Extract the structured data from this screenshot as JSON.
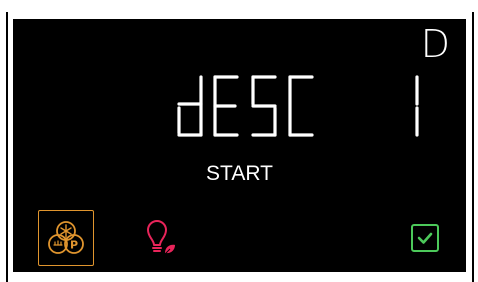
{
  "display": {
    "mode_letter": "D",
    "program_code": "dESC",
    "program_number": "1",
    "status": "START"
  },
  "icons": {
    "program": "snowflake-p-circles-icon",
    "light": "bulb-leaf-icon",
    "confirm": "checkbox-check-icon"
  },
  "colors": {
    "screen_background": "#000000",
    "text": "#ffffff",
    "program_accent": "#e0952e",
    "light_accent": "#e8245a",
    "confirm_accent": "#4cc95a"
  }
}
